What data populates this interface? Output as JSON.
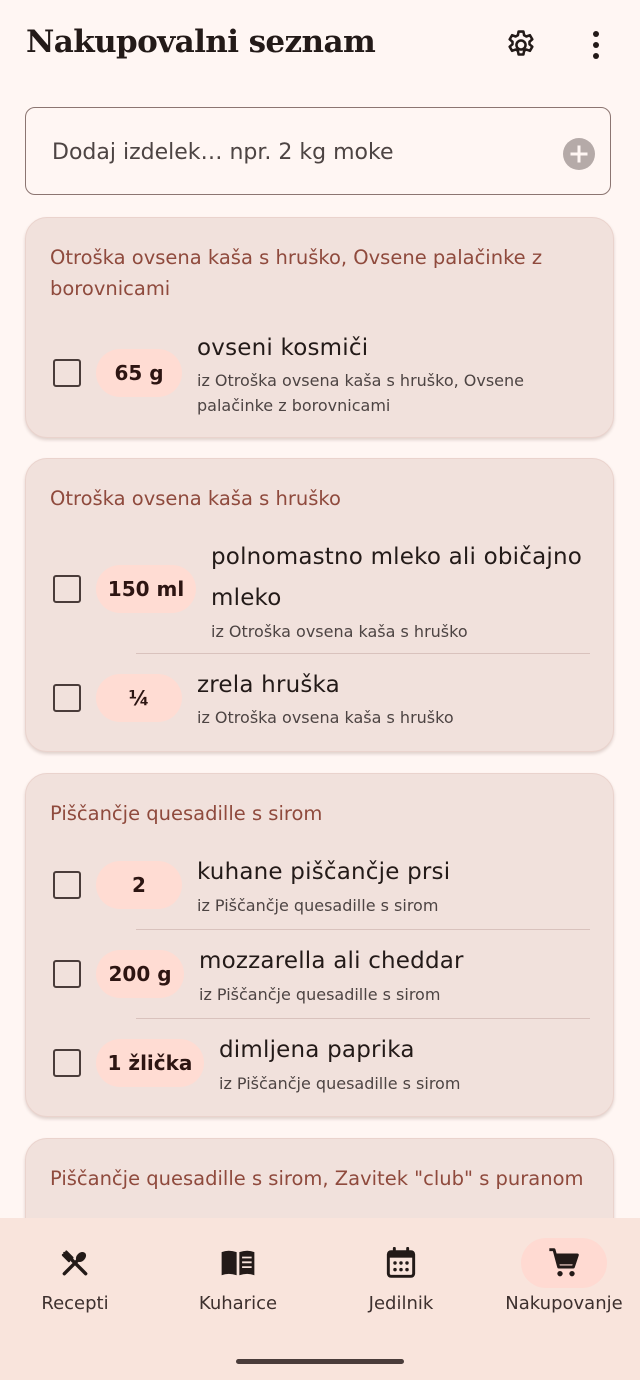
{
  "app": {
    "title": "Nakupovalni seznam",
    "settings_icon": "gear-icon",
    "more_icon": "more-vert-icon"
  },
  "add_item": {
    "placeholder": "Dodaj izdelek… npr. 2 kg moke",
    "icon": "add-circle-icon"
  },
  "groups": [
    {
      "title": "Otroška ovsena kaša s hruško, Ovsene palačinke z borovnicami",
      "items": [
        {
          "quantity": "65 g",
          "name": "ovseni kosmiči",
          "source": "iz Otroška ovsena kaša s hruško, Ovsene palačinke z borovnicami",
          "checked": false
        }
      ]
    },
    {
      "title": "Otroška ovsena kaša s hruško",
      "items": [
        {
          "quantity": "150 ml",
          "name": "polnomastno mleko ali običajno mleko",
          "source": "iz Otroška ovsena kaša s hruško",
          "checked": false
        },
        {
          "quantity": "¼",
          "name": "zrela hruška",
          "source": "iz Otroška ovsena kaša s hruško",
          "checked": false
        }
      ]
    },
    {
      "title": "Piščančje quesadille s sirom",
      "items": [
        {
          "quantity": "2",
          "name": "kuhane piščančje prsi",
          "source": "iz Piščančje quesadille s sirom",
          "checked": false
        },
        {
          "quantity": "200 g",
          "name": "mozzarella ali cheddar",
          "source": "iz Piščančje quesadille s sirom",
          "checked": false
        },
        {
          "quantity": "1 žlička",
          "name": "dimljena paprika",
          "source": "iz Piščančje quesadille s sirom",
          "checked": false
        }
      ]
    },
    {
      "title": "Piščančje quesadille s sirom, Zavitek \"club\" s puranom",
      "items": []
    }
  ],
  "nav": {
    "items": [
      {
        "label": "Recepti",
        "icon": "utensils-icon",
        "active": false
      },
      {
        "label": "Kuharice",
        "icon": "book-icon",
        "active": false
      },
      {
        "label": "Jedilnik",
        "icon": "calendar-icon",
        "active": false
      },
      {
        "label": "Nakupovanje",
        "icon": "shopping-cart-icon",
        "active": true
      }
    ]
  },
  "colors": {
    "background": "#fff6f3",
    "card": "#f1e1dc",
    "group_title": "#8f4a3d",
    "quantity_chip": "#ffdcd3",
    "nav_background": "#f9e4dc",
    "nav_active": "#ffdad2"
  }
}
